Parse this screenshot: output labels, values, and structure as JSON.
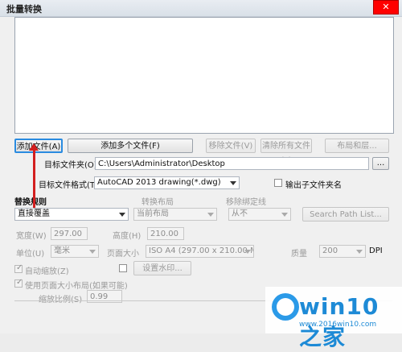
{
  "window": {
    "title": "批量转换"
  },
  "buttons": {
    "add_file": "添加文件(A)",
    "add_multiple": "添加多个文件(F)",
    "remove_file": "移除文件(V)",
    "clear_all": "清除所有文件(L)",
    "layout": "布局和层...",
    "browse": "...",
    "search_path": "Search Path List...",
    "watermark": "设置水印..."
  },
  "target_folder": {
    "label": "目标文件夹(O)",
    "value": "C:\\Users\\Administrator\\Desktop"
  },
  "target_format": {
    "label": "目标文件格式(T)",
    "value": "AutoCAD 2013 drawing(*.dwg)"
  },
  "output_subfolder": {
    "label": "输出子文件夹名"
  },
  "replace_rule": {
    "title": "替换规则",
    "value": "直接覆盖"
  },
  "convert_layout": {
    "label": "转换布局",
    "value": "当前布局"
  },
  "remove_xref": {
    "label": "移除绑定线",
    "value": "从不"
  },
  "width": {
    "label": "宽度(W)",
    "value": "297.00"
  },
  "height": {
    "label": "高度(H)",
    "value": "210.00"
  },
  "unit": {
    "label": "单位(U)",
    "value": "毫米"
  },
  "page_size": {
    "label": "页面大小",
    "value": "ISO A4 (297.00 x 210.00 MM)"
  },
  "quality": {
    "label": "质量",
    "value": "200",
    "suffix": "DPI"
  },
  "auto_scale": {
    "label": "自动缩放(Z)"
  },
  "use_page_layout": {
    "label": "使用页面大小布局(如果可能)"
  },
  "scale_ratio": {
    "label": "缩放比例(S)",
    "value": "0.99"
  },
  "watermark_overlay": {
    "text": "win10之家",
    "sub": "www.2016win10.com"
  },
  "colors": {
    "accent": "#2a8be0",
    "annotation_red": "#d31f1f"
  }
}
